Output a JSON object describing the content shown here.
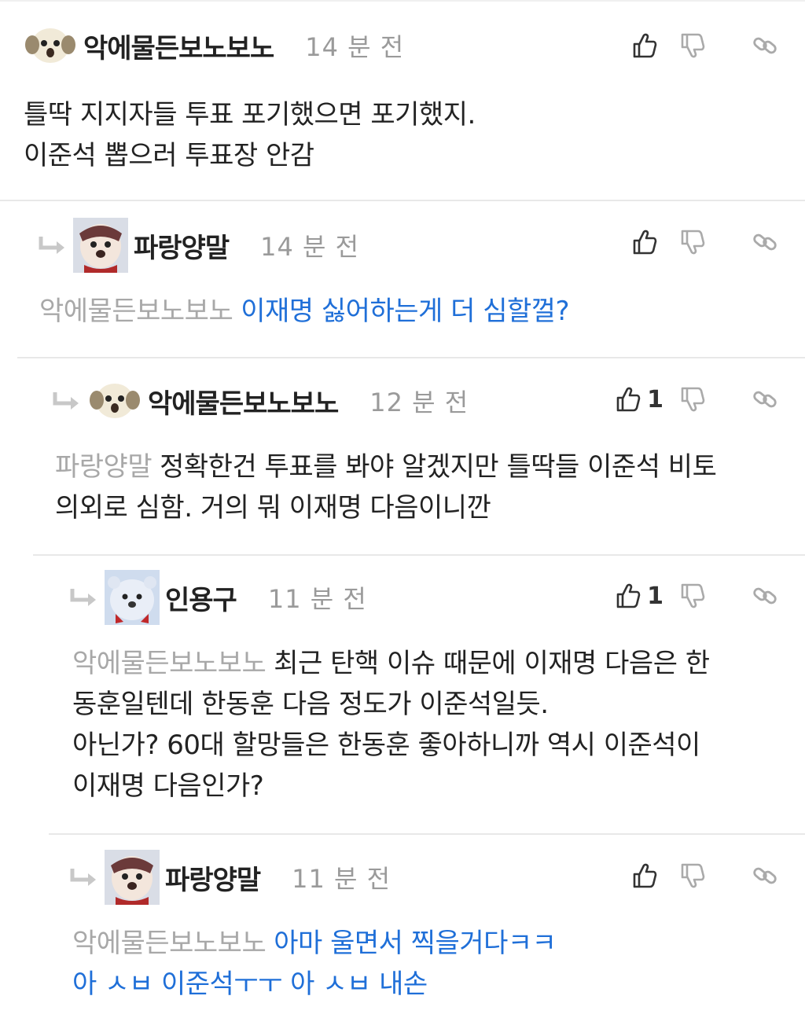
{
  "comments": [
    {
      "author": "악에물든보노보노",
      "time": "14 분 전",
      "likes": "",
      "avatar_icon": "puppy-face-icon",
      "mention": "",
      "lines": [
        "틀딱 지지자들 투표 포기했으면 포기했지.",
        "이준석 뽑으러 투표장 안감"
      ],
      "text_color": "#222222"
    },
    {
      "author": "파랑양말",
      "time": "14 분 전",
      "likes": "",
      "avatar_icon": "dog-avatar-icon",
      "mention": "악에물든보노보노",
      "lines": [
        "이재명 싫어하는게 더 심할껄?"
      ],
      "text_color": "#1f6fd8"
    },
    {
      "author": "악에물든보노보노",
      "time": "12 분 전",
      "likes": "1",
      "avatar_icon": "puppy-face-icon",
      "mention": "파랑양말",
      "lines": [
        "정확한건 투표를 봐야 알겠지만 틀딱들 이준석 비토",
        "의외로 심함. 거의 뭐 이재명 다음이니깐"
      ],
      "text_color": "#222222"
    },
    {
      "author": "인용구",
      "time": "11 분 전",
      "likes": "1",
      "avatar_icon": "polar-bear-avatar-icon",
      "mention": "악에물든보노보노",
      "lines": [
        "최근 탄핵 이슈 때문에 이재명 다음은 한",
        "동훈일텐데 한동훈 다음 정도가 이준석일듯.",
        "아닌가? 60대 할망들은 한동훈 좋아하니까 역시 이준석이",
        "이재명 다음인가?"
      ],
      "text_color": "#222222"
    },
    {
      "author": "파랑양말",
      "time": "11 분 전",
      "likes": "",
      "avatar_icon": "dog-avatar-icon",
      "mention": "악에물든보노보노",
      "lines": [
        "아마 울면서 찍을거다ㅋㅋ",
        "아 ㅅㅂ 이준석ㅜㅜ 아 ㅅㅂ 내손"
      ],
      "text_color": "#1f6fd8"
    }
  ]
}
